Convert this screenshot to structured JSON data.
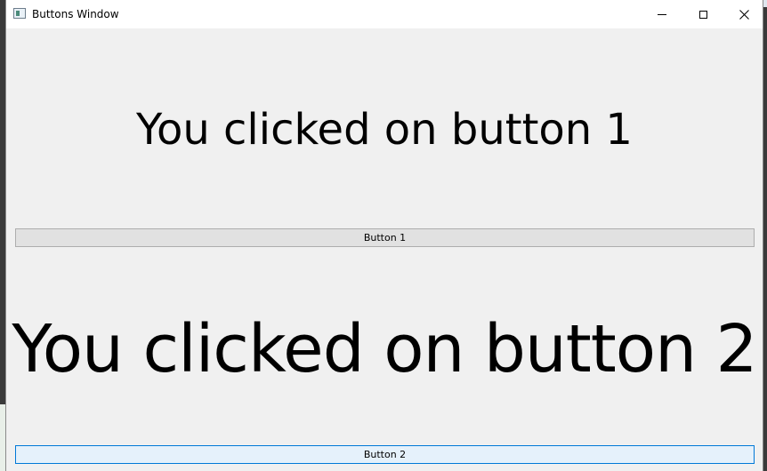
{
  "window": {
    "title": "Buttons Window",
    "controls": {
      "minimize": "minimize-icon",
      "maximize": "maximize-icon",
      "close": "close-icon",
      "close_glyph": "✕"
    }
  },
  "labels": {
    "label1": "You clicked on button 1",
    "label2": "You clicked on button 2"
  },
  "buttons": [
    {
      "label": "Button 1",
      "state": "normal"
    },
    {
      "label": "Button 2",
      "state": "focused"
    }
  ],
  "colors": {
    "window_bg": "#f0f0f0",
    "button_bg": "#e1e1e1",
    "button_focus_bg": "#e5f1fb",
    "button_focus_border": "#0078d7"
  }
}
